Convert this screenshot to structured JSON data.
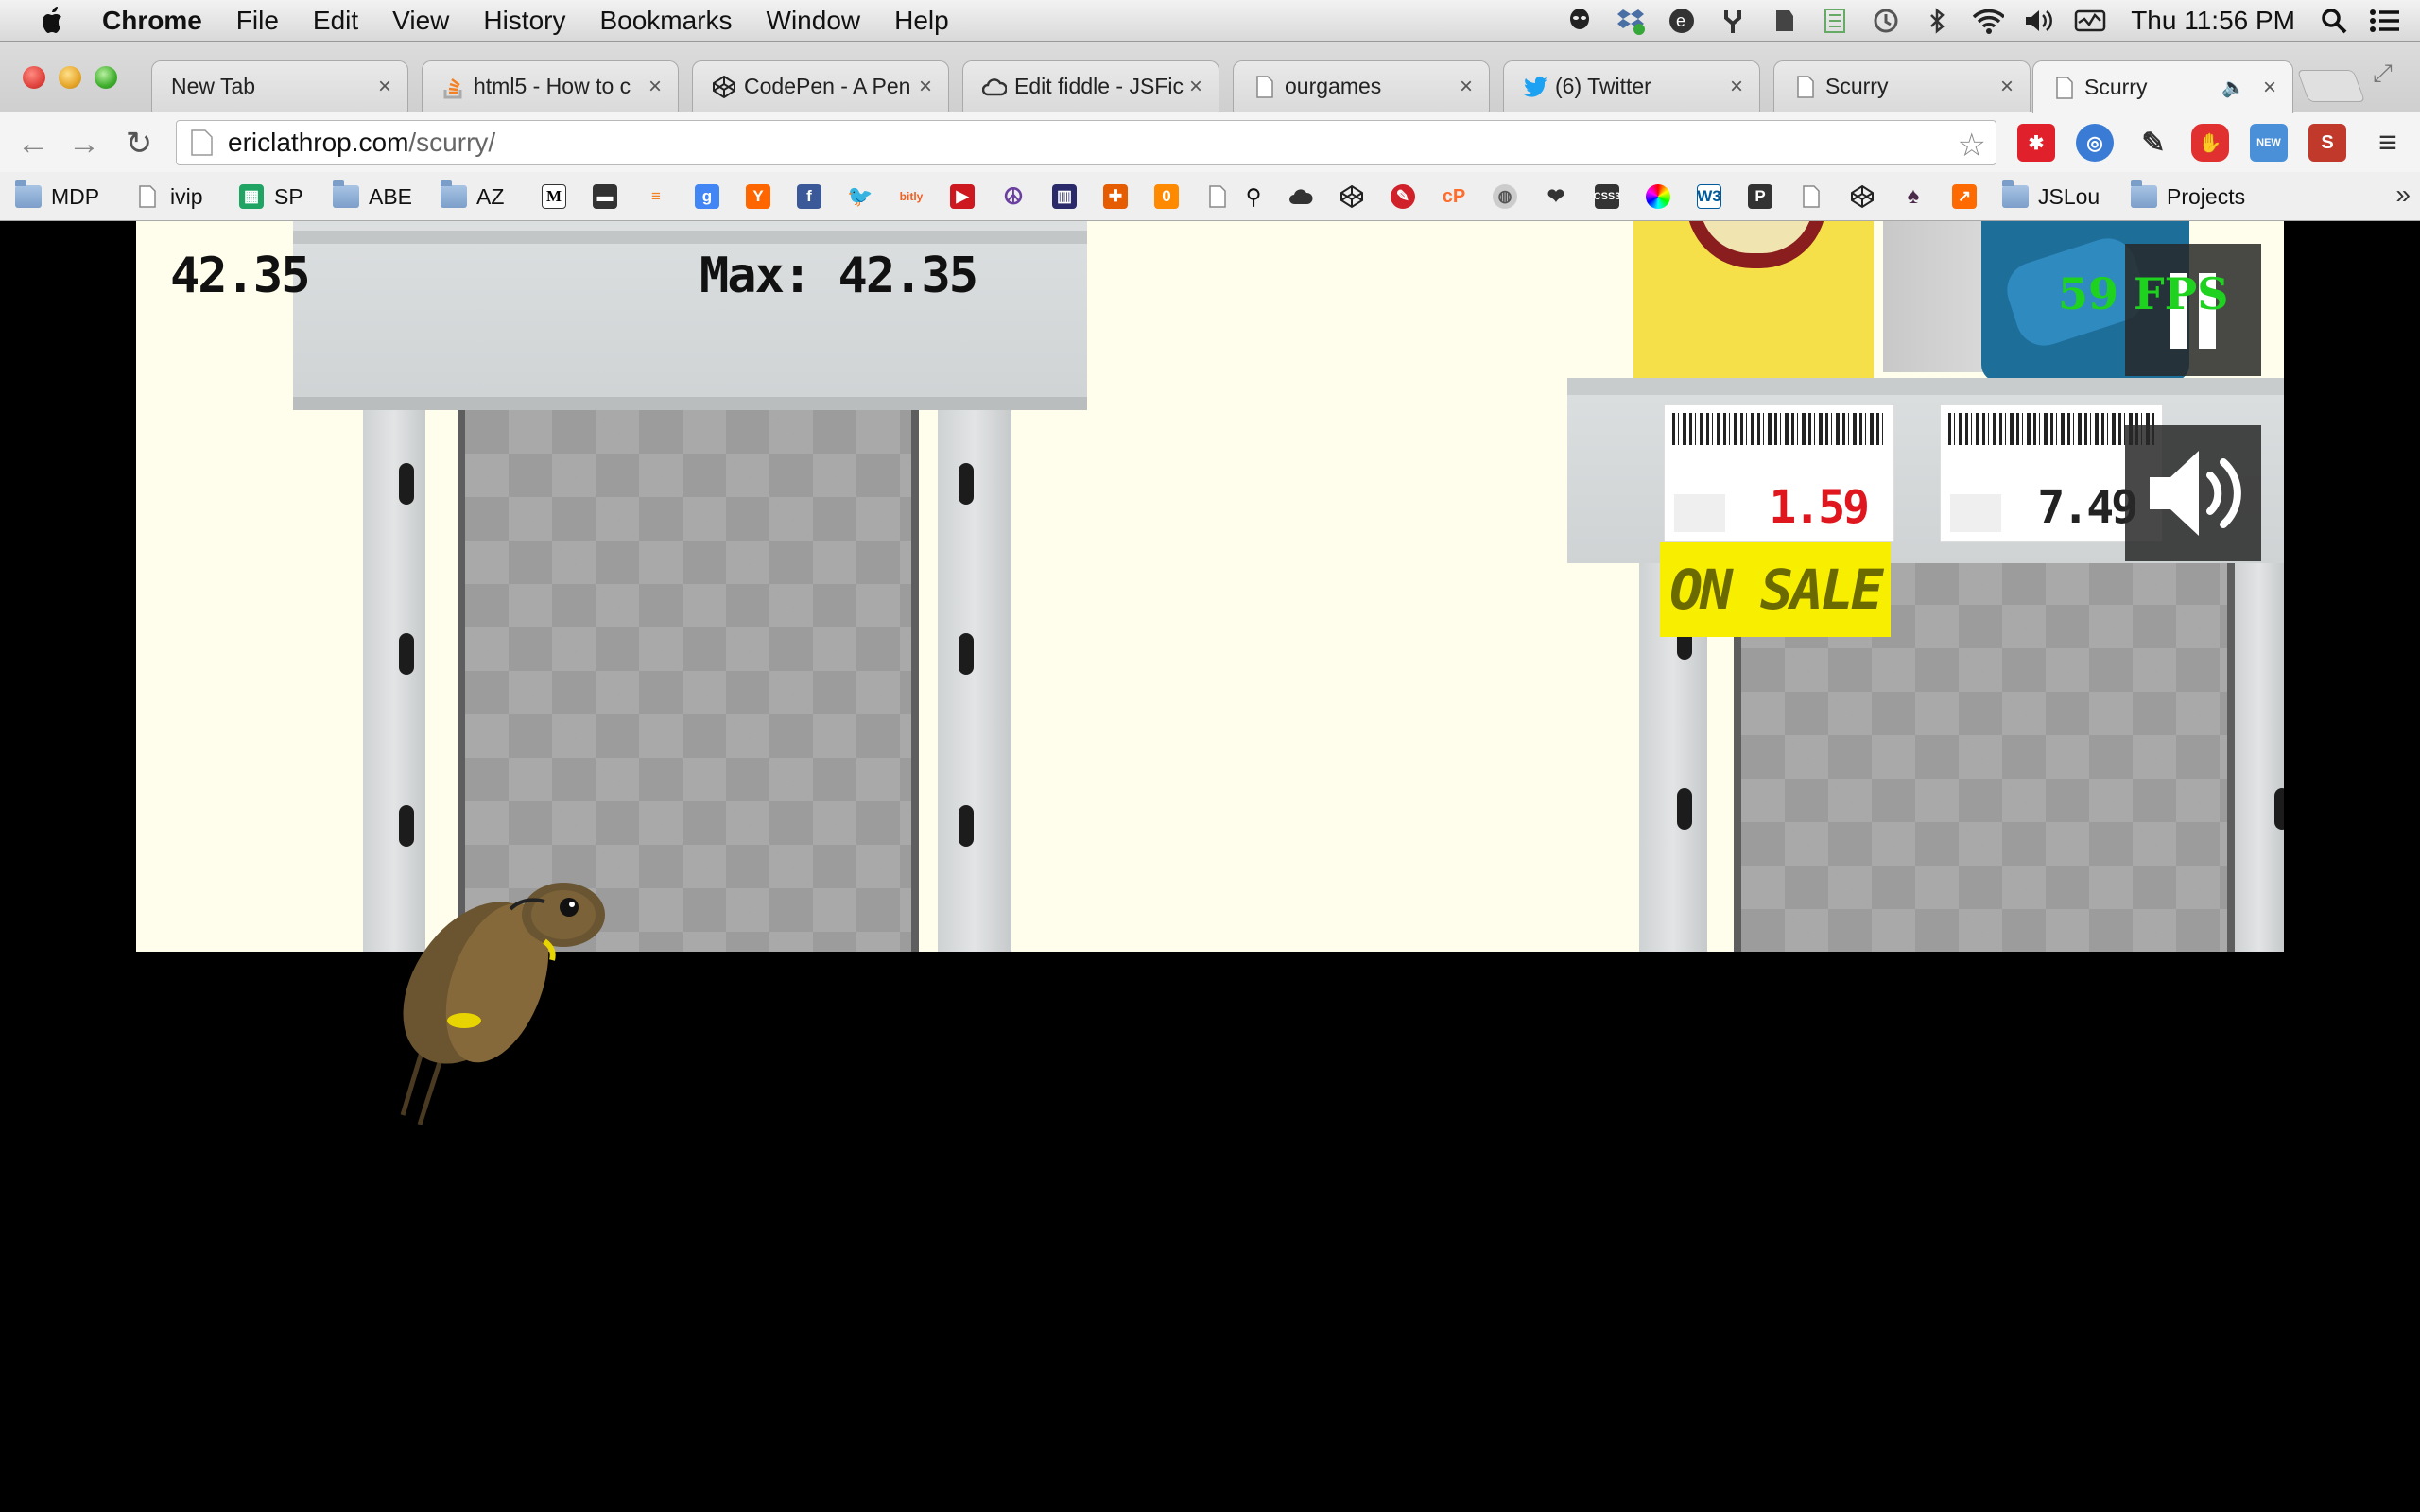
{
  "menubar": {
    "app_name": "Chrome",
    "items": [
      "File",
      "Edit",
      "View",
      "History",
      "Bookmarks",
      "Window",
      "Help"
    ],
    "clock": "Thu 11:56 PM"
  },
  "tabs": [
    {
      "title": "New Tab",
      "icon": "blank-icon"
    },
    {
      "title": "html5 - How to c",
      "icon": "stackoverflow-icon"
    },
    {
      "title": "CodePen - A Pen",
      "icon": "codepen-icon"
    },
    {
      "title": "Edit fiddle - JSFic",
      "icon": "jsfiddle-icon"
    },
    {
      "title": "ourgames",
      "icon": "page-icon"
    },
    {
      "title": "(6) Twitter",
      "icon": "twitter-icon"
    },
    {
      "title": "Scurry",
      "icon": "page-icon"
    },
    {
      "title": "Scurry",
      "icon": "page-icon",
      "active": true
    }
  ],
  "omnibox": {
    "host": "ericlathrop.com",
    "path": "/scurry/"
  },
  "bookmarks": [
    "MDP",
    "ivip",
    "SP",
    "ABE",
    "AZ",
    "JSLou",
    "Projects"
  ],
  "game": {
    "score": "42.35",
    "max_label": "Max: 42.35",
    "fps": "59 FPS",
    "price_1": "1.59",
    "price_2": "7.49",
    "sale_label": "ON SALE"
  },
  "colors": {
    "accent_fps": "#1fd21f",
    "sale_yellow": "#f8ee00",
    "price_red": "#e0161e",
    "canvas_bg": "#fffdec"
  }
}
